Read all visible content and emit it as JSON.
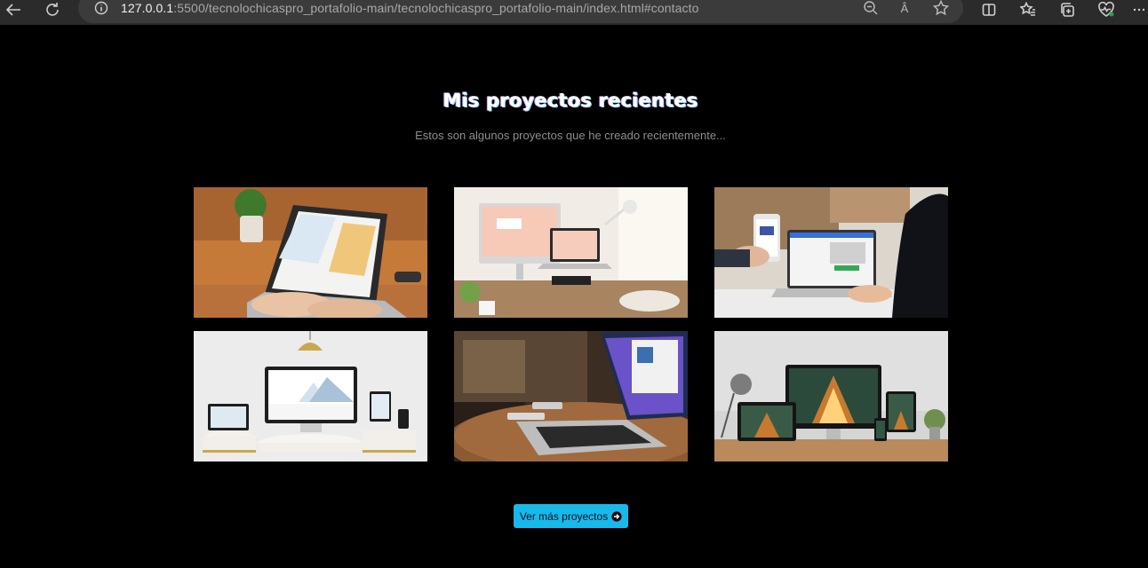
{
  "browser": {
    "url_host": "127.0.0.1",
    "url_path": ":5500/tecnolochicaspro_portafolio-main/tecnolochicaspro_portafolio-main/index.html#contacto",
    "read_aloud_label": "Â"
  },
  "projects": {
    "title": "Mis proyectos recientes",
    "subtitle": "Estos son algunos proyectos que he creado recientemente...",
    "items": [
      {
        "image": "laptop-best-design-hands-typing"
      },
      {
        "image": "desk-imac-macbook-find-your-creativity"
      },
      {
        "image": "hands-phone-laptop-web-app"
      },
      {
        "image": "responsive-web-design-devices-marble"
      },
      {
        "image": "laptop-on-round-wooden-table"
      },
      {
        "image": "devices-showing-architecture-site"
      }
    ],
    "more_button_label": "Ver más proyectos"
  },
  "colors": {
    "accent": "#19b8ea",
    "background": "#000000",
    "toolbar": "#2b2b2b"
  }
}
